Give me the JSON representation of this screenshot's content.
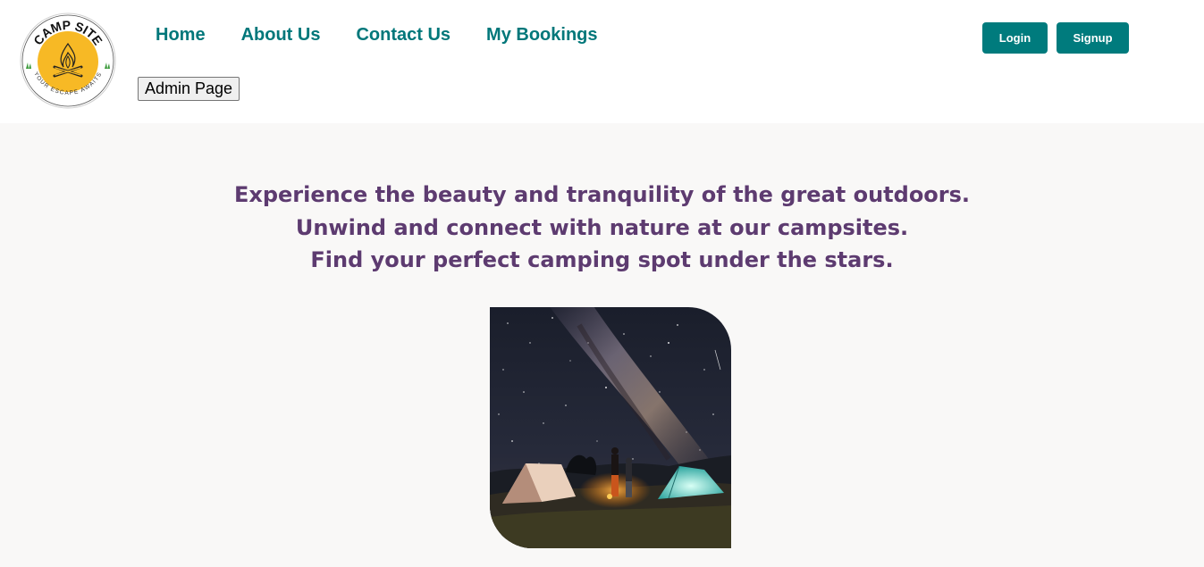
{
  "logo": {
    "title": "CAMP SITE",
    "tagline": "YOUR ESCAPE AWAITS",
    "ring_color": "#ffffff",
    "circle_color": "#f7b925"
  },
  "nav": {
    "items": [
      {
        "label": "Home"
      },
      {
        "label": "About Us"
      },
      {
        "label": "Contact Us"
      },
      {
        "label": "My Bookings"
      }
    ]
  },
  "admin_button": {
    "label": "Admin Page"
  },
  "auth": {
    "login_label": "Login",
    "signup_label": "Signup"
  },
  "hero": {
    "lines": [
      "Experience the beauty and tranquility of the great outdoors.",
      "Unwind and connect with nature at our campsites.",
      "Find your perfect camping spot under the stars."
    ]
  },
  "colors": {
    "accent": "#007b7d",
    "nav_text": "#00777a",
    "hero_text": "#5d3b70",
    "background": "#f9f8f7"
  }
}
